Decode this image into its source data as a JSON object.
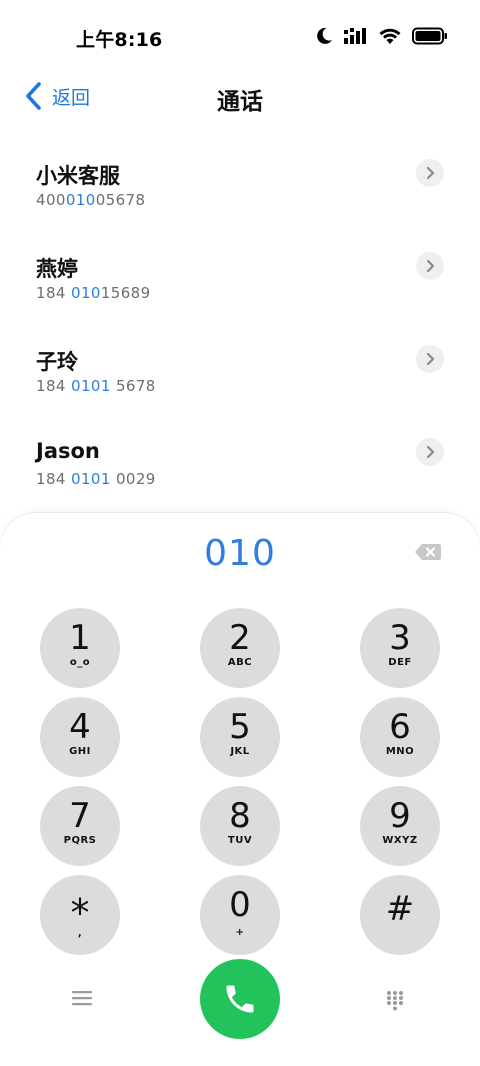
{
  "status_bar": {
    "time": "上午8:16"
  },
  "header": {
    "back_label": "返回",
    "title": "通话"
  },
  "contacts": [
    {
      "name": "小米客服",
      "number": [
        "400",
        "010",
        "05678"
      ]
    },
    {
      "name": "燕婷",
      "number": [
        "184 ",
        "010",
        "15689"
      ]
    },
    {
      "name": "子玲",
      "number": [
        "184 ",
        "0101",
        " 5678"
      ]
    },
    {
      "name": "Jason",
      "number": [
        "184 ",
        "0101",
        " 0029"
      ]
    }
  ],
  "dialer": {
    "input": "010",
    "keys": [
      {
        "digit": "1",
        "letters": "o_o"
      },
      {
        "digit": "2",
        "letters": "ABC"
      },
      {
        "digit": "3",
        "letters": "DEF"
      },
      {
        "digit": "4",
        "letters": "GHI"
      },
      {
        "digit": "5",
        "letters": "JKL"
      },
      {
        "digit": "6",
        "letters": "MNO"
      },
      {
        "digit": "7",
        "letters": "PQRS"
      },
      {
        "digit": "8",
        "letters": "TUV"
      },
      {
        "digit": "9",
        "letters": "WXYZ"
      },
      {
        "digit": "*",
        "letters": ","
      },
      {
        "digit": "0",
        "letters": "+"
      },
      {
        "digit": "#",
        "letters": ""
      }
    ]
  },
  "colors": {
    "accent": "#2f7de0",
    "call": "#22c35b",
    "key": "#dcdcdc"
  },
  "icons": [
    "moon-icon",
    "signal-icon",
    "wifi-icon",
    "battery-icon",
    "back-chevron-icon",
    "chevron-right-icon",
    "backspace-icon",
    "menu-icon",
    "phone-icon",
    "keypad-icon"
  ]
}
